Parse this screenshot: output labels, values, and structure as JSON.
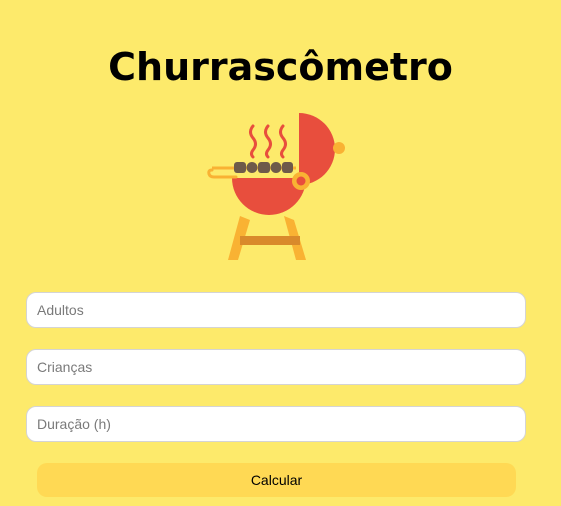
{
  "header": {
    "title": "Churrascômetro"
  },
  "illustration": {
    "icon": "barbecue-grill-icon"
  },
  "form": {
    "adults_placeholder": "Adultos",
    "children_placeholder": "Crianças",
    "duration_placeholder": "Duração (h)",
    "submit_label": "Calcular"
  },
  "colors": {
    "background": "#fdea6b",
    "button": "#ffd954",
    "grill_red": "#e84e3d",
    "grill_orange": "#f9b233",
    "grill_dark": "#6e5a4a"
  }
}
